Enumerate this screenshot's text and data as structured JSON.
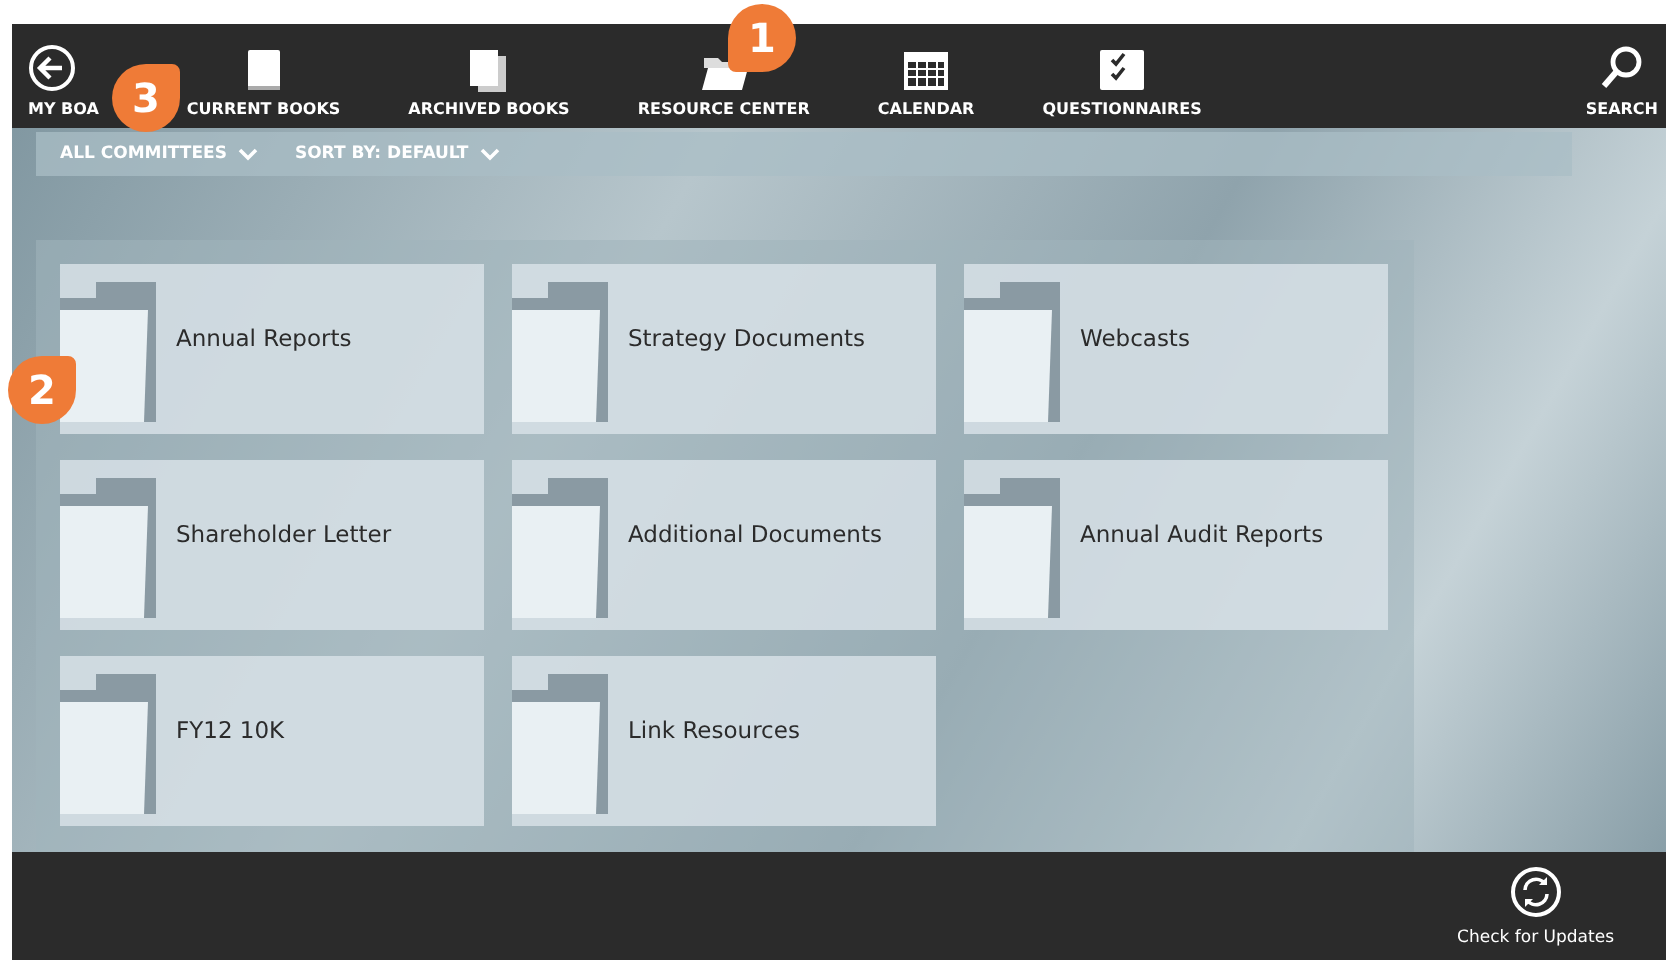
{
  "nav": {
    "back": {
      "label": "MY BOA"
    },
    "items": [
      {
        "kind": "book",
        "label": "CURRENT BOOKS"
      },
      {
        "kind": "books",
        "label": "ARCHIVED BOOKS"
      },
      {
        "kind": "folder",
        "label": "RESOURCE CENTER"
      },
      {
        "kind": "calendar",
        "label": "CALENDAR"
      },
      {
        "kind": "checklist",
        "label": "QUESTIONNAIRES"
      }
    ],
    "search": {
      "label": "SEARCH"
    }
  },
  "filters": [
    {
      "label": "ALL COMMITTEES"
    },
    {
      "label": "SORT BY: DEFAULT"
    }
  ],
  "folders": [
    {
      "name": "Annual Reports"
    },
    {
      "name": "Strategy Documents"
    },
    {
      "name": "Webcasts"
    },
    {
      "name": "Shareholder Letter"
    },
    {
      "name": "Additional Documents"
    },
    {
      "name": "Annual Audit Reports"
    },
    {
      "name": "FY12 10K"
    },
    {
      "name": "Link Resources"
    }
  ],
  "app_bar": {
    "button": "Check for Updates"
  },
  "callouts": [
    {
      "number": "1"
    },
    {
      "number": "2"
    },
    {
      "number": "3"
    }
  ]
}
